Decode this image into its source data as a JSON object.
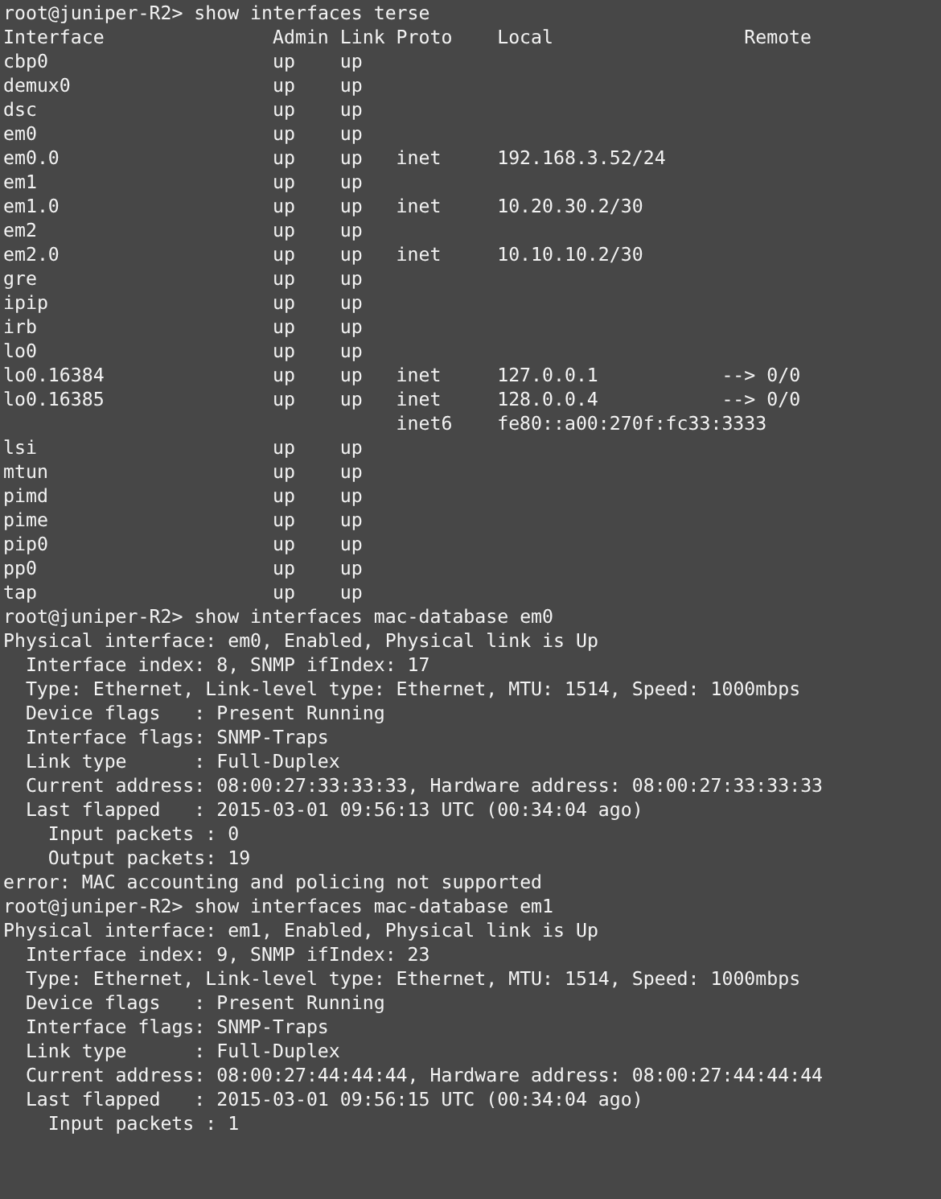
{
  "terminal": {
    "commands": [
      {
        "kind": "table",
        "prompt": "root@juniper-R2> show interfaces terse",
        "columns": [
          "Interface",
          "Admin",
          "Link",
          "Proto",
          "Local",
          "Remote"
        ],
        "rows": [
          {
            "name": "cbp0",
            "admin": "up",
            "link": "up"
          },
          {
            "name": "demux0",
            "admin": "up",
            "link": "up"
          },
          {
            "name": "dsc",
            "admin": "up",
            "link": "up"
          },
          {
            "name": "em0",
            "admin": "up",
            "link": "up"
          },
          {
            "name": "em0.0",
            "admin": "up",
            "link": "up",
            "proto": "inet",
            "local": "192.168.3.52/24"
          },
          {
            "name": "em1",
            "admin": "up",
            "link": "up"
          },
          {
            "name": "em1.0",
            "admin": "up",
            "link": "up",
            "proto": "inet",
            "local": "10.20.30.2/30"
          },
          {
            "name": "em2",
            "admin": "up",
            "link": "up"
          },
          {
            "name": "em2.0",
            "admin": "up",
            "link": "up",
            "proto": "inet",
            "local": "10.10.10.2/30"
          },
          {
            "name": "gre",
            "admin": "up",
            "link": "up"
          },
          {
            "name": "ipip",
            "admin": "up",
            "link": "up"
          },
          {
            "name": "irb",
            "admin": "up",
            "link": "up"
          },
          {
            "name": "lo0",
            "admin": "up",
            "link": "up"
          },
          {
            "name": "lo0.16384",
            "admin": "up",
            "link": "up",
            "proto": "inet",
            "local": "127.0.0.1",
            "remote": "--> 0/0"
          },
          {
            "name": "lo0.16385",
            "admin": "up",
            "link": "up",
            "proto": "inet",
            "local": "128.0.0.4",
            "remote": "--> 0/0"
          },
          {
            "proto": "inet6",
            "local": "fe80::a00:270f:fc33:3333"
          },
          {
            "name": "lsi",
            "admin": "up",
            "link": "up"
          },
          {
            "name": "mtun",
            "admin": "up",
            "link": "up"
          },
          {
            "name": "pimd",
            "admin": "up",
            "link": "up"
          },
          {
            "name": "pime",
            "admin": "up",
            "link": "up"
          },
          {
            "name": "pip0",
            "admin": "up",
            "link": "up"
          },
          {
            "name": "pp0",
            "admin": "up",
            "link": "up"
          },
          {
            "name": "tap",
            "admin": "up",
            "link": "up"
          }
        ]
      },
      {
        "kind": "output",
        "prompt": "root@juniper-R2> show interfaces mac-database em0",
        "lines": [
          {
            "kind": "top",
            "text": "Physical interface: em0, Enabled, Physical link is Up"
          },
          {
            "kind": "detail",
            "text": "Interface index: 8, SNMP ifIndex: 17"
          },
          {
            "kind": "detail",
            "text": "Type: Ethernet, Link-level type: Ethernet, MTU: 1514, Speed: 1000mbps"
          },
          {
            "kind": "detail",
            "text": "Device flags   : Present Running"
          },
          {
            "kind": "detail",
            "text": "Interface flags: SNMP-Traps"
          },
          {
            "kind": "detail",
            "text": "Link type      : Full-Duplex"
          },
          {
            "kind": "detail",
            "text": "Current address: 08:00:27:33:33:33, Hardware address: 08:00:27:33:33:33"
          },
          {
            "kind": "detail",
            "text": "Last flapped   : 2015-03-01 09:56:13 UTC (00:34:04 ago)"
          },
          {
            "kind": "subdetail",
            "text": "Input packets : 0"
          },
          {
            "kind": "subdetail",
            "text": "Output packets: 19"
          },
          {
            "kind": "top",
            "text": "error: MAC accounting and policing not supported"
          }
        ]
      },
      {
        "kind": "output",
        "prompt": "root@juniper-R2> show interfaces mac-database em1",
        "lines": [
          {
            "kind": "top",
            "text": "Physical interface: em1, Enabled, Physical link is Up"
          },
          {
            "kind": "detail",
            "text": "Interface index: 9, SNMP ifIndex: 23"
          },
          {
            "kind": "detail",
            "text": "Type: Ethernet, Link-level type: Ethernet, MTU: 1514, Speed: 1000mbps"
          },
          {
            "kind": "detail",
            "text": "Device flags   : Present Running"
          },
          {
            "kind": "detail",
            "text": "Interface flags: SNMP-Traps"
          },
          {
            "kind": "detail",
            "text": "Link type      : Full-Duplex"
          },
          {
            "kind": "detail",
            "text": "Current address: 08:00:27:44:44:44, Hardware address: 08:00:27:44:44:44"
          },
          {
            "kind": "detail",
            "text": "Last flapped   : 2015-03-01 09:56:15 UTC (00:34:04 ago)"
          },
          {
            "kind": "subdetail",
            "text": "Input packets : 1"
          }
        ]
      }
    ]
  }
}
